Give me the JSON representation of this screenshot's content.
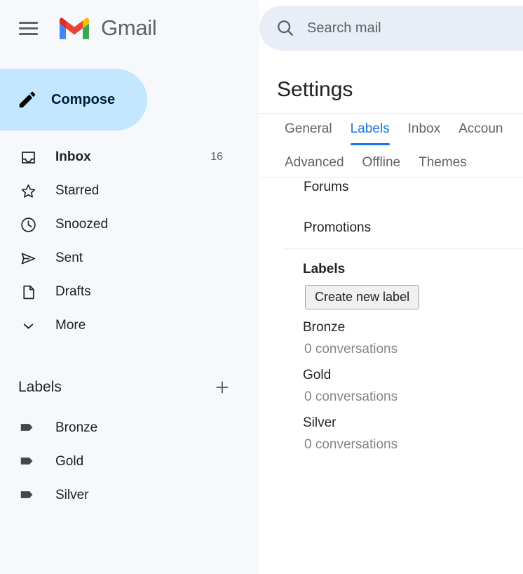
{
  "sidebar": {
    "menu_icon": "hamburger-menu-icon",
    "brand": "Gmail",
    "logo_colors": {
      "red": "#d93025",
      "blue": "#4285f4",
      "green": "#34a853",
      "yellow": "#fbbc04"
    },
    "compose": {
      "label": "Compose",
      "icon": "pencil-icon",
      "background": "#c2e7ff"
    },
    "nav_items": [
      {
        "label": "Inbox",
        "icon": "inbox-icon",
        "count": "16",
        "active": true
      },
      {
        "label": "Starred",
        "icon": "star-icon",
        "count": "",
        "active": false
      },
      {
        "label": "Snoozed",
        "icon": "clock-icon",
        "count": "",
        "active": false
      },
      {
        "label": "Sent",
        "icon": "send-icon",
        "count": "",
        "active": false
      },
      {
        "label": "Drafts",
        "icon": "document-icon",
        "count": "",
        "active": false
      },
      {
        "label": "More",
        "icon": "chevron-down-icon",
        "count": "",
        "active": false
      }
    ],
    "labels_section": {
      "title": "Labels",
      "add_icon": "plus-icon",
      "items": [
        {
          "label": "Bronze",
          "icon": "tag-icon"
        },
        {
          "label": "Gold",
          "icon": "tag-icon"
        },
        {
          "label": "Silver",
          "icon": "tag-icon"
        }
      ]
    }
  },
  "search": {
    "icon": "search-icon",
    "placeholder": "Search mail",
    "value": ""
  },
  "settings": {
    "title": "Settings",
    "accent_color": "#1a73e8",
    "tabs_row1": [
      {
        "label": "General",
        "selected": false
      },
      {
        "label": "Labels",
        "selected": true
      },
      {
        "label": "Inbox",
        "selected": false
      },
      {
        "label": "Accoun",
        "selected": false
      }
    ],
    "tabs_row2": [
      {
        "label": "Advanced",
        "selected": false
      },
      {
        "label": "Offline",
        "selected": false
      },
      {
        "label": "Themes",
        "selected": false
      }
    ],
    "categories": [
      {
        "name": "Forums"
      },
      {
        "name": "Promotions"
      }
    ],
    "labels_section": {
      "heading": "Labels",
      "create_button": "Create new label",
      "labels": [
        {
          "name": "Bronze",
          "conversations": "0 conversations"
        },
        {
          "name": "Gold",
          "conversations": "0 conversations"
        },
        {
          "name": "Silver",
          "conversations": "0 conversations"
        }
      ]
    }
  }
}
